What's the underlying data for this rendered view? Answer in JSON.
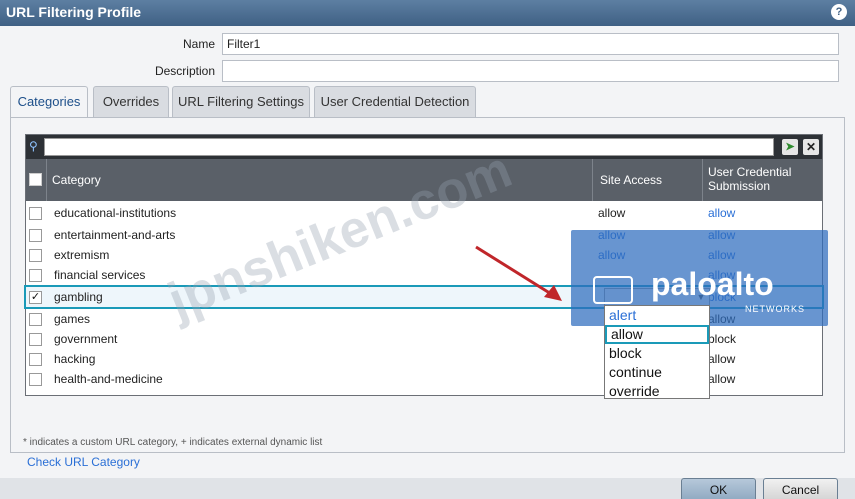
{
  "window": {
    "title": "URL Filtering Profile"
  },
  "form": {
    "name_label": "Name",
    "name_value": "Filter1",
    "description_label": "Description",
    "description_value": ""
  },
  "tabs": [
    {
      "label": "Categories",
      "active": true
    },
    {
      "label": "Overrides"
    },
    {
      "label": "URL Filtering Settings"
    },
    {
      "label": "User Credential Detection"
    }
  ],
  "grid": {
    "columns": {
      "category": "Category",
      "site_access": "Site Access",
      "user_credential_line1": "User Credential",
      "user_credential_line2": "Submission"
    },
    "rows": [
      {
        "category": "educational-institutions",
        "site_access": "allow",
        "user_credential": "allow"
      },
      {
        "category": "entertainment-and-arts",
        "site_access": "allow",
        "user_credential": "allow"
      },
      {
        "category": "extremism",
        "site_access": "allow",
        "user_credential": "allow"
      },
      {
        "category": "financial services",
        "site_access": "",
        "user_credential": "allow"
      },
      {
        "category": "gambling",
        "site_access": "allow",
        "user_credential": "block",
        "checked": true
      },
      {
        "category": "games",
        "site_access": "",
        "user_credential": "allow"
      },
      {
        "category": "government",
        "site_access": "",
        "user_credential": "block"
      },
      {
        "category": "hacking",
        "site_access": "",
        "user_credential": "allow"
      },
      {
        "category": "health-and-medicine",
        "site_access": "",
        "user_credential": "allow"
      }
    ],
    "dropdown_options": [
      "alert",
      "allow",
      "block",
      "continue",
      "override"
    ]
  },
  "note": "* indicates a custom URL category, + indicates external dynamic list",
  "check_link": "Check URL Category",
  "buttons": {
    "ok": "OK",
    "cancel": "Cancel"
  },
  "logo": {
    "text": "paloalto",
    "sub": "NETWORKS"
  },
  "watermark": "jpnshiken.com",
  "colors": {
    "titlebar": "#3f6084",
    "selection": "#1a9ab8",
    "link": "#2a6fd6"
  }
}
